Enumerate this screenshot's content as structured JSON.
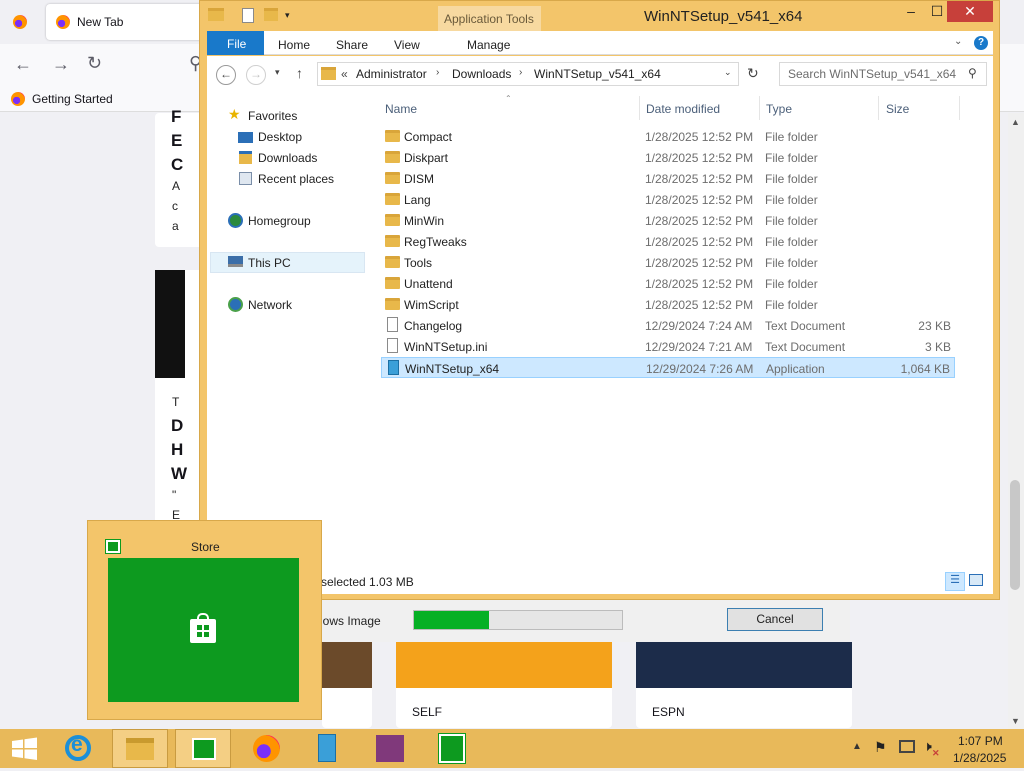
{
  "firefox": {
    "tab_title": "New Tab",
    "bookmark": "Getting Started",
    "cards": {
      "card1_letters": [
        "F",
        "E",
        "C",
        "A",
        "c",
        "a"
      ],
      "card2_letters": [
        "T",
        "D",
        "H",
        "W",
        "\"",
        "E"
      ],
      "bottom_labels": [
        "SELF",
        "ESPN"
      ]
    }
  },
  "explorer": {
    "title": "WinNTSetup_v541_x64",
    "contextual_tab": "Application Tools",
    "ribbon_tabs": [
      "File",
      "Home",
      "Share",
      "View",
      "Manage"
    ],
    "breadcrumb": [
      "Administrator",
      "Downloads",
      "WinNTSetup_v541_x64"
    ],
    "breadcrumb_prefix": "«",
    "search_placeholder": "Search WinNTSetup_v541_x64",
    "nav": {
      "favorites": "Favorites",
      "favorites_items": [
        "Desktop",
        "Downloads",
        "Recent places"
      ],
      "homegroup": "Homegroup",
      "this_pc": "This PC",
      "network": "Network"
    },
    "columns": [
      "Name",
      "Date modified",
      "Type",
      "Size"
    ],
    "files": [
      {
        "name": "Compact",
        "date": "1/28/2025 12:52 PM",
        "type": "File folder",
        "size": "",
        "kind": "folder"
      },
      {
        "name": "Diskpart",
        "date": "1/28/2025 12:52 PM",
        "type": "File folder",
        "size": "",
        "kind": "folder"
      },
      {
        "name": "DISM",
        "date": "1/28/2025 12:52 PM",
        "type": "File folder",
        "size": "",
        "kind": "folder"
      },
      {
        "name": "Lang",
        "date": "1/28/2025 12:52 PM",
        "type": "File folder",
        "size": "",
        "kind": "folder"
      },
      {
        "name": "MinWin",
        "date": "1/28/2025 12:52 PM",
        "type": "File folder",
        "size": "",
        "kind": "folder"
      },
      {
        "name": "RegTweaks",
        "date": "1/28/2025 12:52 PM",
        "type": "File folder",
        "size": "",
        "kind": "folder"
      },
      {
        "name": "Tools",
        "date": "1/28/2025 12:52 PM",
        "type": "File folder",
        "size": "",
        "kind": "folder"
      },
      {
        "name": "Unattend",
        "date": "1/28/2025 12:52 PM",
        "type": "File folder",
        "size": "",
        "kind": "folder"
      },
      {
        "name": "WimScript",
        "date": "1/28/2025 12:52 PM",
        "type": "File folder",
        "size": "",
        "kind": "folder"
      },
      {
        "name": "Changelog",
        "date": "12/29/2024 7:24 AM",
        "type": "Text Document",
        "size": "23 KB",
        "kind": "doc"
      },
      {
        "name": "WinNTSetup.ini",
        "date": "12/29/2024 7:21 AM",
        "type": "Text Document",
        "size": "3 KB",
        "kind": "doc"
      },
      {
        "name": "WinNTSetup_x64",
        "date": "12/29/2024 7:26 AM",
        "type": "Application",
        "size": "1,064 KB",
        "kind": "app",
        "selected": true
      }
    ],
    "status": "selected  1.03 MB"
  },
  "progress_dialog": {
    "label": "lows Image",
    "progress": 0.36,
    "cancel": "Cancel"
  },
  "store_preview": {
    "title": "Store"
  },
  "clock": {
    "time": "1:07 PM",
    "date": "1/28/2025"
  }
}
